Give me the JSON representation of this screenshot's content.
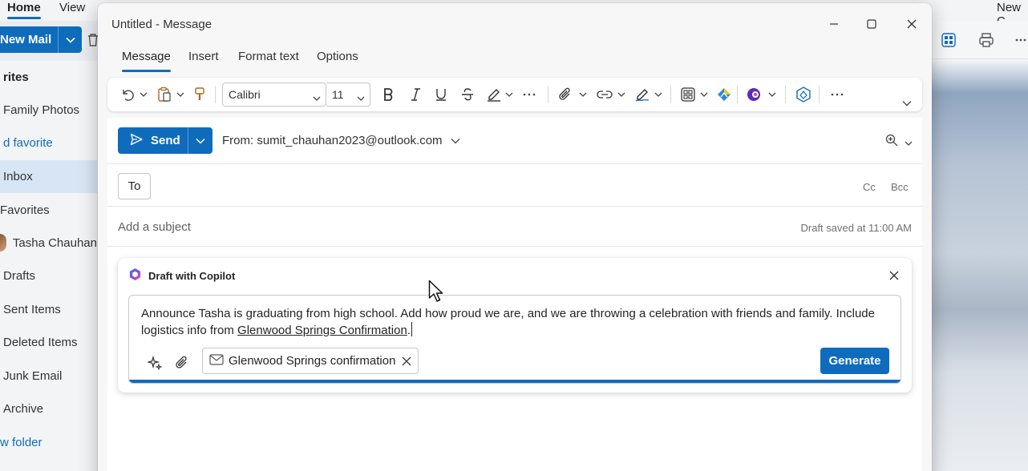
{
  "bg": {
    "tabs": {
      "home": "Home",
      "view": "View",
      "new_c": "New C"
    },
    "new_mail_label": "New Mail",
    "sidebar": [
      {
        "label": "rites",
        "kind": "section"
      },
      {
        "label": "Family Photos",
        "kind": "item"
      },
      {
        "label": "d favorite",
        "kind": "link"
      },
      {
        "label": "Inbox",
        "kind": "active"
      },
      {
        "label": "Favorites",
        "kind": "item"
      },
      {
        "label": "Tasha Chauhan",
        "kind": "person"
      },
      {
        "label": "Drafts",
        "kind": "item"
      },
      {
        "label": "Sent Items",
        "kind": "item"
      },
      {
        "label": "Deleted Items",
        "kind": "item"
      },
      {
        "label": "Junk Email",
        "kind": "item"
      },
      {
        "label": "Archive",
        "kind": "item"
      },
      {
        "label": "w folder",
        "kind": "link"
      }
    ]
  },
  "window": {
    "title": "Untitled - Message"
  },
  "tabs": [
    "Message",
    "Insert",
    "Format text",
    "Options"
  ],
  "ribbon": {
    "font": "Calibri",
    "size": "11"
  },
  "compose": {
    "send_label": "Send",
    "from_label": "From: sumit_chauhan2023@outlook.com",
    "to_label": "To",
    "cc_label": "Cc",
    "bcc_label": "Bcc",
    "subject_placeholder": "Add a subject",
    "draft_saved": "Draft saved at 11:00 AM"
  },
  "copilot": {
    "title": "Draft with Copilot",
    "prompt_text": "Announce Tasha is graduating from high school. Add how proud we are, and we are throwing a celebration with friends and family. Include logistics info from ",
    "prompt_ref": "Glenwood Springs Confirmation",
    "prompt_end": ".",
    "chip_label": "Glenwood Springs confirmation",
    "generate_label": "Generate"
  },
  "colors": {
    "accent": "#0f6cbd"
  }
}
